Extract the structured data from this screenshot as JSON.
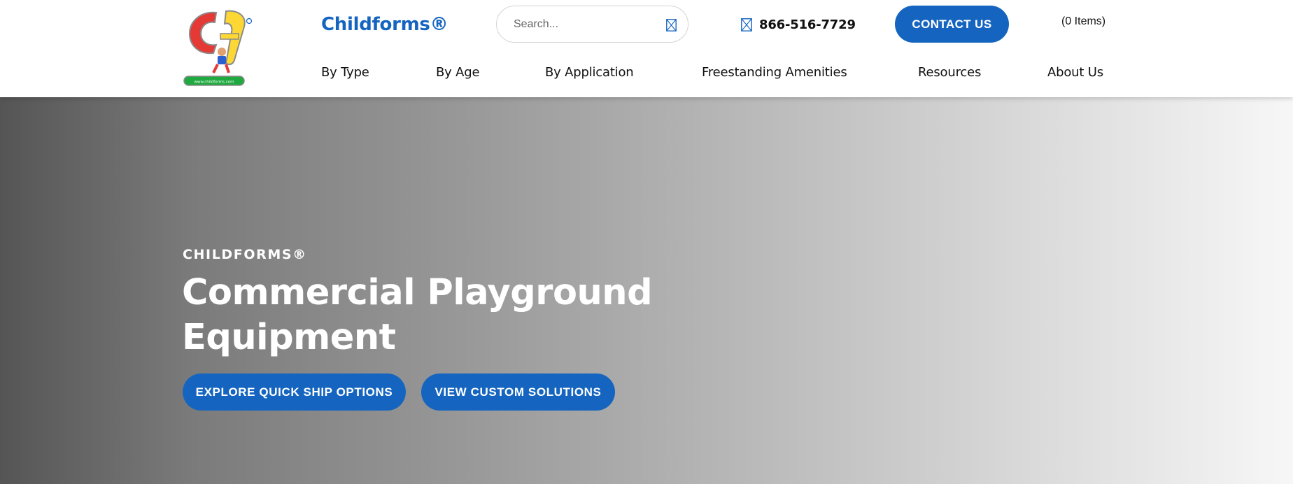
{
  "header": {
    "brand_name": "Childforms®",
    "logo_url_text": "www.childforms.com",
    "search": {
      "placeholder": "Search...",
      "value": ""
    },
    "phone": "866-516-7729",
    "contact_label": "CONTACT US",
    "cart_label": "(0 Items)"
  },
  "nav": {
    "items": [
      {
        "label": "By Type"
      },
      {
        "label": "By Age"
      },
      {
        "label": "By Application"
      },
      {
        "label": "Freestanding Amenities"
      },
      {
        "label": "Resources"
      },
      {
        "label": "About Us"
      }
    ]
  },
  "hero": {
    "eyebrow": "CHILDFORMS®",
    "title_line1": "Commercial Playground",
    "title_line2": "Equipment",
    "buttons": [
      {
        "label": "EXPLORE QUICK SHIP OPTIONS"
      },
      {
        "label": "VIEW CUSTOM SOLUTIONS"
      }
    ]
  },
  "colors": {
    "accent": "#1565c0",
    "logo_red": "#e53935",
    "logo_yellow": "#fdd835",
    "logo_green": "#1faa3f"
  },
  "icons": {
    "search": "search-icon",
    "phone": "phone-icon",
    "logo": "childforms-logo"
  }
}
